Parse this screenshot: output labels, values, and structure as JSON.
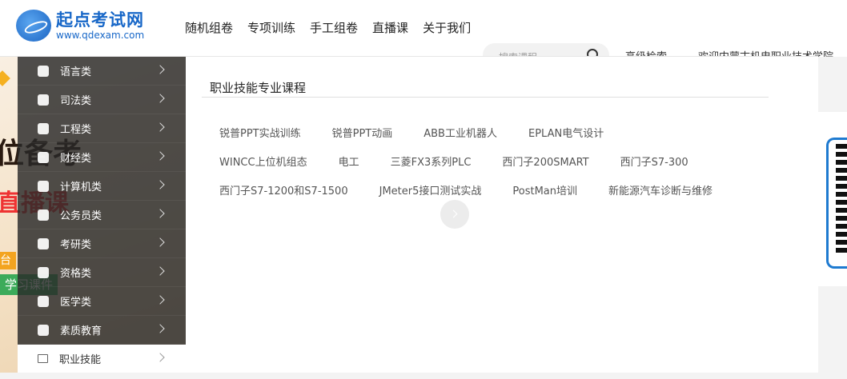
{
  "header": {
    "logo_title": "起点考试网",
    "logo_url": "www.qdexam.com",
    "nav": [
      "随机组卷",
      "专项训练",
      "手工组卷",
      "直播课",
      "关于我们"
    ],
    "search_placeholder": "搜索课程",
    "advanced_search": "高级检索",
    "welcome": "欢迎内蒙古机电职业技术学院"
  },
  "banner": {
    "headline": "位备考",
    "live": "直播课",
    "tai": "台",
    "course_tag": "学习课件"
  },
  "sidebar": {
    "items": [
      {
        "label": "语言类",
        "icon": "globe-icon"
      },
      {
        "label": "司法类",
        "icon": "gavel-icon"
      },
      {
        "label": "工程类",
        "icon": "building-icon"
      },
      {
        "label": "财经类",
        "icon": "finance-icon"
      },
      {
        "label": "计算机类",
        "icon": "computer-icon"
      },
      {
        "label": "公务员类",
        "icon": "person-icon"
      },
      {
        "label": "考研类",
        "icon": "graduation-cap-icon"
      },
      {
        "label": "资格类",
        "icon": "certificate-icon"
      },
      {
        "label": "医学类",
        "icon": "medical-icon"
      },
      {
        "label": "素质教育",
        "icon": "users-icon"
      },
      {
        "label": "职业技能",
        "icon": "briefcase-icon"
      }
    ]
  },
  "panel": {
    "title": "职业技能专业课程",
    "rows": [
      [
        "锐普PPT实战训练",
        "锐普PPT动画",
        "ABB工业机器人",
        "EPLAN电气设计"
      ],
      [
        "WINCC上位机组态",
        "电工",
        "三菱FX3系列PLC",
        "西门子200SMART",
        "西门子S7-300"
      ],
      [
        "西门子S7-1200和S7-1500",
        "JMeter5接口测试实战",
        "PostMan培训",
        "新能源汽车诊断与维修"
      ]
    ]
  },
  "colors": {
    "brand": "#1767c8",
    "sidebar_bg": "#2e2e2e",
    "qr_frame": "#1e7ad0"
  }
}
